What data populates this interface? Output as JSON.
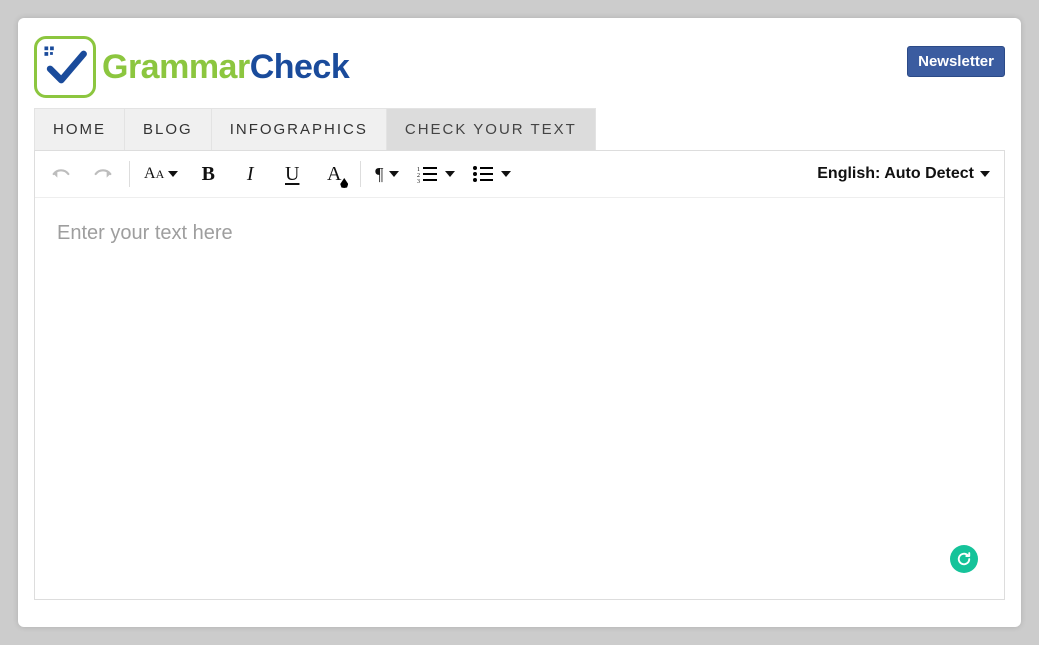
{
  "brand": {
    "part1": "Grammar",
    "part2": "Check"
  },
  "header": {
    "newsletter_label": "Newsletter"
  },
  "nav": {
    "items": [
      {
        "label": "HOME",
        "active": false
      },
      {
        "label": "BLOG",
        "active": false
      },
      {
        "label": "INFOGRAPHICS",
        "active": false
      },
      {
        "label": "CHECK YOUR TEXT",
        "active": true
      }
    ]
  },
  "toolbar": {
    "undo": "↶",
    "redo": "↷",
    "language_label": "English: Auto Detect"
  },
  "editor": {
    "placeholder": "Enter your text here"
  }
}
